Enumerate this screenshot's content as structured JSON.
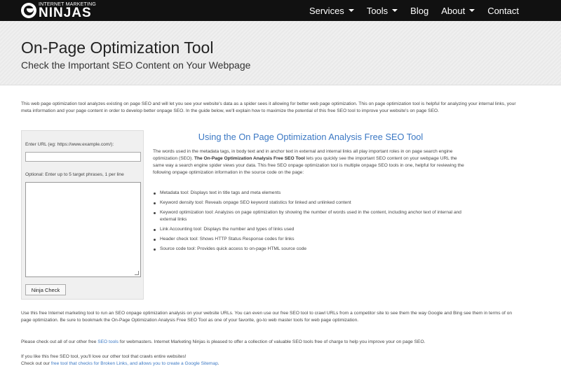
{
  "brand": {
    "small": "INTERNET MARKETING",
    "big": "NINJAS"
  },
  "nav": [
    {
      "label": "Services",
      "dropdown": true
    },
    {
      "label": "Tools",
      "dropdown": true
    },
    {
      "label": "Blog",
      "dropdown": false
    },
    {
      "label": "About",
      "dropdown": true
    },
    {
      "label": "Contact",
      "dropdown": false
    }
  ],
  "hero": {
    "title": "On-Page Optimization Tool",
    "subtitle": "Check the Important SEO Content on Your Webpage"
  },
  "intro": "This web page optimization tool analyzes existing on page SEO and will let you see your website's data as a spider sees it allowing for better web page optimization. This on page optimization tool is helpful for analyzing your internal links, your meta information and your page content in order to develop better onpage SEO. In the guide below, we'll explain how to maximize the potential of this free SEO tool to improve your website's on page SEO.",
  "form": {
    "url_label": "Enter URL (eg: https://www.example.com/):",
    "url_value": "",
    "phrases_label": "Optional: Enter up to 5 target phrases, 1 per line",
    "phrases_value": "",
    "button": "Ninja Check"
  },
  "guide": {
    "title": "Using the On Page Optimization Analysis Free SEO Tool",
    "p_before": "The words used in the metadata tags, in body text and in anchor text in external and internal links all play important roles in on page search engine optimization (SEO). ",
    "p_bold": "The On-Page Optimization Analysis Free SEO Tool",
    "p_after": " lets you quickly see the important SEO content on your webpage URL the same way a search engine spider views your data. This free SEO onpage optimization tool is multiple onpage SEO tools in one, helpful for reviewing the following onpage optimization information in the source code on the page:",
    "items": [
      "Metadata tool: Displays text in title tags and meta elements",
      "Keyword density tool: Reveals onpage SEO keyword statistics for linked and unlinked content",
      "Keyword optimization tool: Analyzes on page optimization by showing the number of words used in the content, including anchor text of internal and external links",
      "Link Accounting tool: Displays the number and types of links used",
      "Header check tool: Shows HTTP Status Response codes for links",
      "Source code tool: Provides quick access to on-page HTML source code"
    ]
  },
  "bottom": {
    "p1": "Use this free Internet marketing tool to run an SEO onpage optimization analysis on your website URLs. You can even use our free SEO tool to crawl URLs from a competitor site to see them the way Google and Bing see them in terms of on page optimization. Be sure to bookmark the On-Page Optimization Analysis Free SEO Tool as one of your favorite, go-to web master tools for web page optimization.",
    "p2_before": "Please check out all of our other free ",
    "p2_link": "SEO tools",
    "p2_after": " for webmasters. Internet Marketing Ninjas is pleased to offer a collection of valuable SEO tools free of charge to help you improve your on page SEO.",
    "p3_line1": "If you like this free SEO tool, you'll love our other tool that crawls entire websites!",
    "p3_before": "Check out our ",
    "p3_link": "free tool that checks for Broken Links, and allows you to create a Google Sitemap",
    "p3_after": "."
  }
}
